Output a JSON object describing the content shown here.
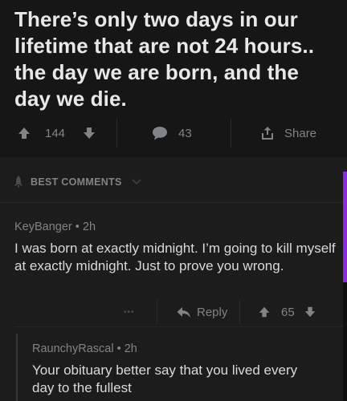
{
  "post": {
    "title": "There’s only two days in our lifetime that are not 24 hours.. the day we are born, and the day we die.",
    "upvotes": "144",
    "comments": "43",
    "share_label": "Share"
  },
  "comments_section": {
    "sort_label": "BEST COMMENTS"
  },
  "comments": [
    {
      "author": "KeyBanger",
      "age": "2h",
      "body": "I was born at exactly midnight. I’m going to kill myself at exactly midnight. Just to prove you wrong.",
      "more_label": "•••",
      "reply_label": "Reply",
      "score": "65"
    },
    {
      "author": "RaunchyRascal",
      "age": "2h",
      "body": "Your obituary better say that you lived every day to the fullest"
    }
  ],
  "colors": {
    "background": "#1a1a1b",
    "text_primary": "#d7dadc",
    "text_muted": "#818384",
    "edge_accent": "#8a2be2"
  }
}
